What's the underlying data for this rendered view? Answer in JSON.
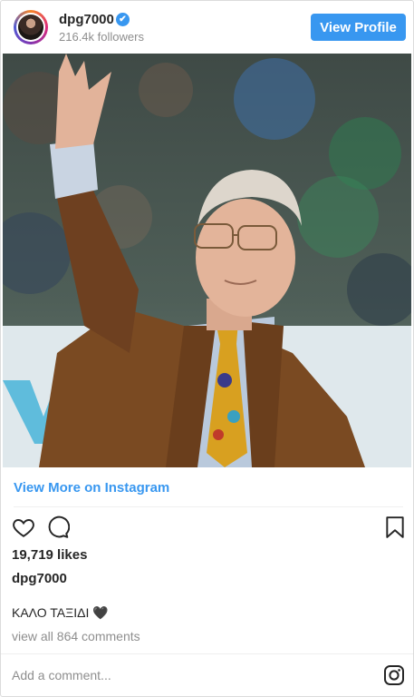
{
  "header": {
    "username": "dpg7000",
    "verified_glyph": "✔",
    "followers": "216.4k followers",
    "view_profile_label": "View Profile"
  },
  "post": {
    "image_alt": "Elderly man in brown jacket waving at a basketball arena",
    "view_more_label": "View More on Instagram",
    "likes": "19,719 likes",
    "caption_user": "dpg7000",
    "caption_text": "ΚΑΛΟ ΤΑΞΙΔΙ 🖤",
    "comments_link": "view all 864 comments",
    "add_comment_placeholder": "Add a comment..."
  },
  "icons": {
    "like": "heart-icon",
    "comment": "comment-icon",
    "save": "bookmark-icon",
    "brand": "instagram-icon"
  },
  "colors": {
    "accent": "#3897f0",
    "text": "#262626",
    "muted": "#8e8e8e"
  }
}
